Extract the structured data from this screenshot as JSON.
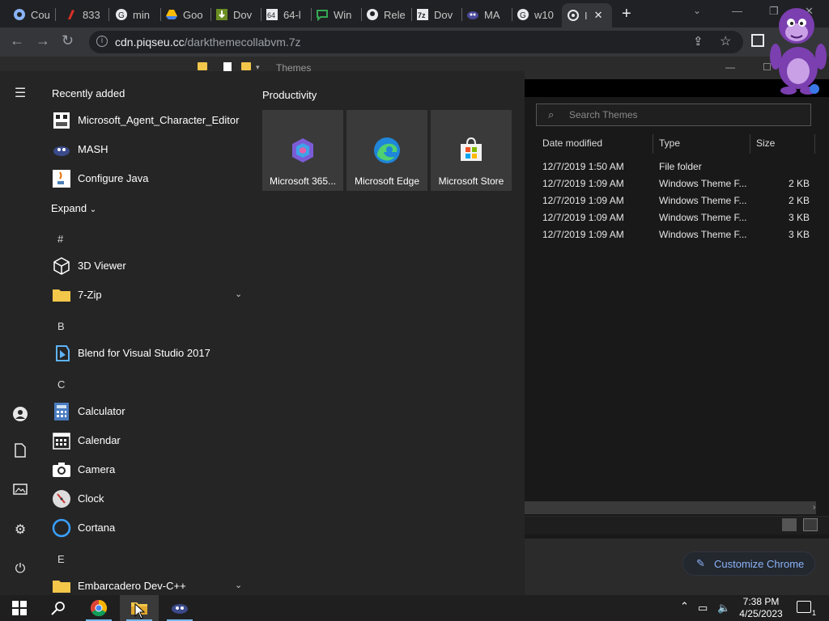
{
  "browser": {
    "tabs": [
      {
        "label": "Cou",
        "icon": "google-icon"
      },
      {
        "label": "833",
        "icon": "red-favicon-icon"
      },
      {
        "label": "min",
        "icon": "google-icon"
      },
      {
        "label": "Goo",
        "icon": "google-drive-icon"
      },
      {
        "label": "Dov",
        "icon": "download-site-icon"
      },
      {
        "label": "64-l",
        "icon": "64bit-site-icon"
      },
      {
        "label": "Win",
        "icon": "chat-bubble-icon"
      },
      {
        "label": "Rele",
        "icon": "github-icon"
      },
      {
        "label": "Dov",
        "icon": "7zip-icon"
      },
      {
        "label": "MA",
        "icon": "mash-icon"
      },
      {
        "label": "w10",
        "icon": "google-icon"
      },
      {
        "label": "I",
        "icon": "chrome-loading-icon",
        "active": true
      }
    ],
    "new_tab_symbol": "+",
    "url_host": "cdn.piqseu.cc",
    "url_path": "/darkthemecollabvm.7z",
    "customize_label": "Customize Chrome"
  },
  "explorer": {
    "title": "Themes",
    "search_placeholder": "Search Themes",
    "columns": [
      "Date modified",
      "Type",
      "Size"
    ],
    "rows": [
      {
        "date": "12/7/2019 1:50 AM",
        "type": "File folder",
        "size": ""
      },
      {
        "date": "12/7/2019 1:09 AM",
        "type": "Windows Theme F...",
        "size": "2 KB"
      },
      {
        "date": "12/7/2019 1:09 AM",
        "type": "Windows Theme F...",
        "size": "2 KB"
      },
      {
        "date": "12/7/2019 1:09 AM",
        "type": "Windows Theme F...",
        "size": "3 KB"
      },
      {
        "date": "12/7/2019 1:09 AM",
        "type": "Windows Theme F...",
        "size": "3 KB"
      }
    ]
  },
  "start_menu": {
    "recently_added_label": "Recently added",
    "recent": [
      {
        "label": "Microsoft_Agent_Character_Editor",
        "icon": "agent-editor-icon"
      },
      {
        "label": "MASH",
        "icon": "mash-icon"
      },
      {
        "label": "Configure Java",
        "icon": "java-icon"
      }
    ],
    "expand_label": "Expand",
    "groups": [
      {
        "letter": "#",
        "apps": [
          {
            "label": "3D Viewer",
            "icon": "cube-icon"
          },
          {
            "label": "7-Zip",
            "icon": "folder-icon",
            "expandable": true
          }
        ]
      },
      {
        "letter": "B",
        "apps": [
          {
            "label": "Blend for Visual Studio 2017",
            "icon": "blend-icon"
          }
        ]
      },
      {
        "letter": "C",
        "apps": [
          {
            "label": "Calculator",
            "icon": "calculator-icon"
          },
          {
            "label": "Calendar",
            "icon": "calendar-icon"
          },
          {
            "label": "Camera",
            "icon": "camera-icon"
          },
          {
            "label": "Clock",
            "icon": "clock-icon"
          },
          {
            "label": "Cortana",
            "icon": "cortana-icon"
          }
        ]
      },
      {
        "letter": "E",
        "apps": [
          {
            "label": "Embarcadero Dev-C++",
            "icon": "folder-icon",
            "expandable": true
          }
        ]
      }
    ],
    "tiles_title": "Productivity",
    "tiles": [
      {
        "label": "Microsoft 365...",
        "icon": "microsoft-365-icon"
      },
      {
        "label": "Microsoft Edge",
        "icon": "edge-icon"
      },
      {
        "label": "Microsoft Store",
        "icon": "store-icon"
      }
    ],
    "rail": [
      "hamburger-icon",
      "user-icon",
      "documents-icon",
      "pictures-icon",
      "settings-icon",
      "power-icon"
    ]
  },
  "taskbar": {
    "time": "7:38 PM",
    "date": "4/25/2023",
    "notification_count": "1",
    "pinned": [
      "start-icon",
      "search-icon",
      "chrome-icon",
      "file-explorer-icon",
      "mash-icon"
    ]
  }
}
